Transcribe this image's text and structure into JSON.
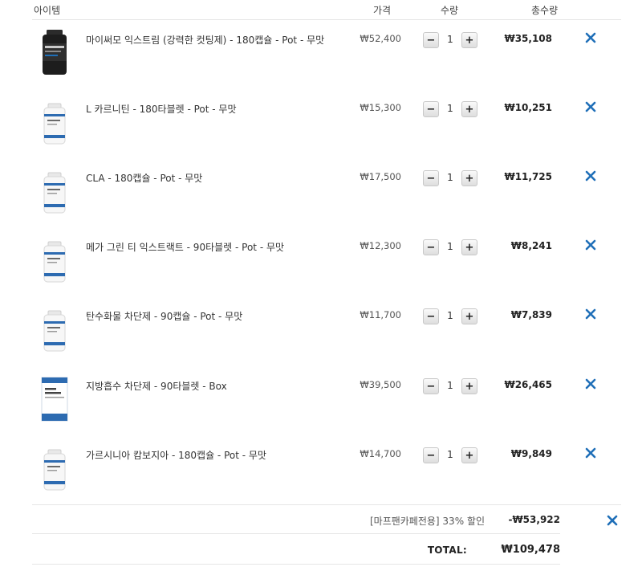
{
  "header": {
    "item": "아이템",
    "price": "가격",
    "quantity": "수량",
    "total": "총수량"
  },
  "colors": {
    "remove_icon": "#1f6fb8"
  },
  "items": [
    {
      "name": "마이써모 익스트림 (강력한 컷팅제) - 180캡슐 - Pot - 무맛",
      "price": "₩52,400",
      "quantity": "1",
      "total": "₩35,108",
      "image": "dark-bottle"
    },
    {
      "name": "L 카르니틴 - 180타블렛 - Pot - 무맛",
      "price": "₩15,300",
      "quantity": "1",
      "total": "₩10,251",
      "image": "white-bottle"
    },
    {
      "name": "CLA - 180캡슐 - Pot - 무맛",
      "price": "₩17,500",
      "quantity": "1",
      "total": "₩11,725",
      "image": "white-bottle"
    },
    {
      "name": "메가 그린 티 익스트랙트 - 90타블렛 - Pot - 무맛",
      "price": "₩12,300",
      "quantity": "1",
      "total": "₩8,241",
      "image": "white-bottle"
    },
    {
      "name": "탄수화물 차단제 - 90캡슐 - Pot - 무맛",
      "price": "₩11,700",
      "quantity": "1",
      "total": "₩7,839",
      "image": "white-bottle"
    },
    {
      "name": "지방흡수 차단제 - 90타블렛 - Box",
      "price": "₩39,500",
      "quantity": "1",
      "total": "₩26,465",
      "image": "box"
    },
    {
      "name": "가르시니아 캄보지아 - 180캡슐 - Pot - 무맛",
      "price": "₩14,700",
      "quantity": "1",
      "total": "₩9,849",
      "image": "white-bottle"
    }
  ],
  "buttons": {
    "minus": "−",
    "plus": "+"
  },
  "discount": {
    "label": "[마프팬카페전용] 33% 할인",
    "value": "-₩53,922"
  },
  "summary": {
    "total_label": "TOTAL:",
    "total_value": "₩109,478"
  }
}
